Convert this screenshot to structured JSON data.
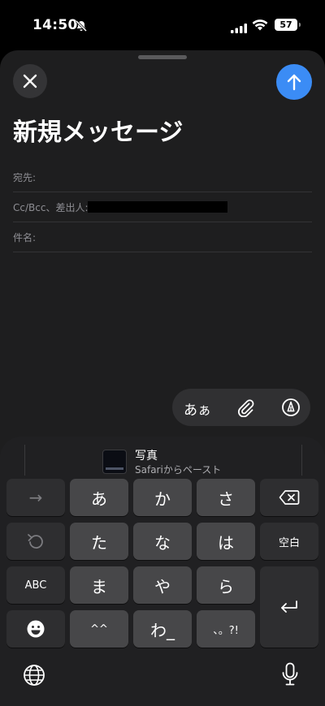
{
  "status_bar": {
    "time": "14:50",
    "battery": "57"
  },
  "compose": {
    "title": "新規メッセージ",
    "to_label": "宛先:",
    "cc_label": "Cc/Bcc、差出人:",
    "subject_label": "件名:"
  },
  "toolbar": {
    "text_format": "あぁ"
  },
  "keyboard": {
    "suggestion_title": "写真",
    "suggestion_subtitle": "Safariからペースト",
    "keys": {
      "next": "→",
      "a": "あ",
      "ka": "か",
      "sa": "さ",
      "ta": "た",
      "na": "な",
      "ha": "は",
      "space": "空白",
      "abc": "ABC",
      "ma": "ま",
      "ya": "や",
      "ra": "ら",
      "dakuten": "^^",
      "wa": "わ_",
      "punct": "、。?!"
    }
  },
  "colors": {
    "accent": "#3b8cf5",
    "sheet": "#1e1e1f",
    "key": "#474749"
  }
}
